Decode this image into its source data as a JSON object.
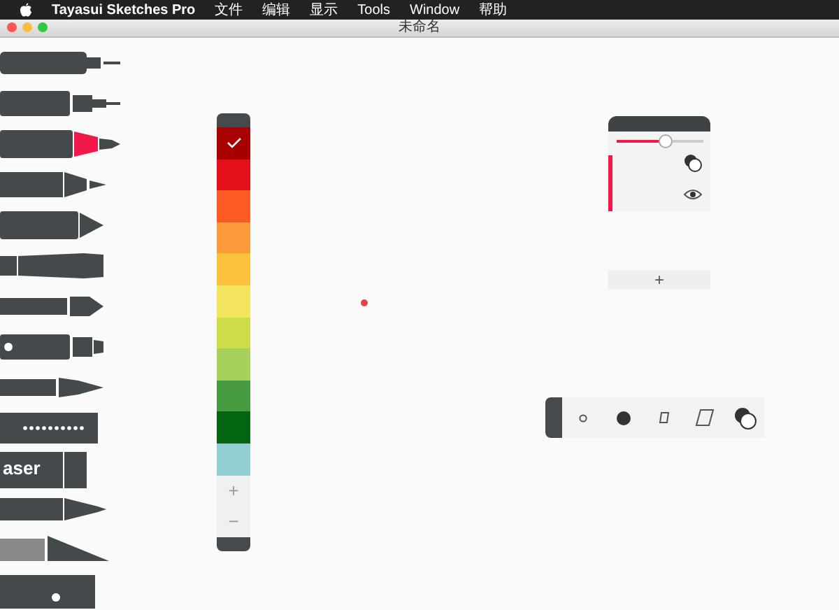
{
  "menu_bar": {
    "app_name": "Tayasui Sketches Pro",
    "items": [
      "文件",
      "编辑",
      "显示",
      "Tools",
      "Window",
      "帮助"
    ]
  },
  "window": {
    "title": "未命名"
  },
  "tools": [
    {
      "kind": "technical-pen"
    },
    {
      "kind": "mechanical-pencil"
    },
    {
      "kind": "marker",
      "color": "#f0194a"
    },
    {
      "kind": "fineliner"
    },
    {
      "kind": "crayon"
    },
    {
      "kind": "pencil"
    },
    {
      "kind": "brush"
    },
    {
      "kind": "airbrush"
    },
    {
      "kind": "fountain-pen"
    },
    {
      "kind": "dotted-block"
    },
    {
      "kind": "eraser",
      "label": "aser"
    },
    {
      "kind": "cutter"
    },
    {
      "kind": "blade"
    },
    {
      "kind": "ruler"
    }
  ],
  "swatches": [
    {
      "color": "#a80000",
      "selected": true
    },
    {
      "color": "#e3101a",
      "selected": false
    },
    {
      "color": "#fb5a22",
      "selected": false
    },
    {
      "color": "#fb9a3a",
      "selected": false
    },
    {
      "color": "#fdc23c",
      "selected": false
    },
    {
      "color": "#f2e45e",
      "selected": false
    },
    {
      "color": "#cddd48",
      "selected": false
    },
    {
      "color": "#a8d05c",
      "selected": false
    },
    {
      "color": "#479b40",
      "selected": false
    },
    {
      "color": "#036512",
      "selected": false
    },
    {
      "color": "#91cdd1",
      "selected": false
    }
  ],
  "swatch_buttons": [
    "+",
    "−"
  ],
  "layers": {
    "opacity": {
      "level": 0.57
    },
    "layer": {
      "color": "#f0194a",
      "visible": true
    },
    "add_button": "+"
  },
  "brush_shapes": [
    {
      "kind": "small-dot"
    },
    {
      "kind": "large-dot"
    },
    {
      "kind": "square"
    },
    {
      "kind": "slanted-square"
    },
    {
      "kind": "blend"
    }
  ]
}
